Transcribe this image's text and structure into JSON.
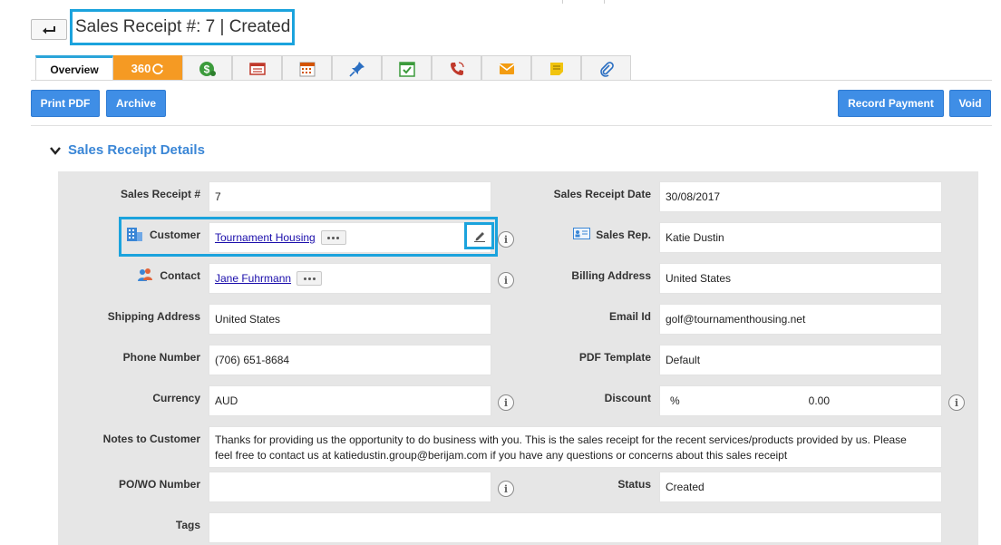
{
  "header": {
    "title": "Sales Receipt #: 7 | Created",
    "back_icon": "back-arrow-icon"
  },
  "tabs": [
    {
      "label": "Overview",
      "icon": "overview"
    },
    {
      "label": "360",
      "icon": "360-refresh-icon"
    },
    {
      "label": "",
      "icon": "payment-dollar-icon"
    },
    {
      "label": "",
      "icon": "invoice-list-icon"
    },
    {
      "label": "",
      "icon": "calendar-icon"
    },
    {
      "label": "",
      "icon": "pin-icon"
    },
    {
      "label": "",
      "icon": "task-check-icon"
    },
    {
      "label": "",
      "icon": "call-phone-icon"
    },
    {
      "label": "",
      "icon": "email-envelope-icon"
    },
    {
      "label": "",
      "icon": "note-icon"
    },
    {
      "label": "",
      "icon": "attachment-paperclip-icon"
    }
  ],
  "toolbar": {
    "print_pdf": "Print PDF",
    "archive": "Archive",
    "record_payment": "Record Payment",
    "void": "Void"
  },
  "section": {
    "title": "Sales Receipt Details"
  },
  "fields": {
    "sales_receipt_no": {
      "label": "Sales Receipt #",
      "value": "7"
    },
    "sales_receipt_date": {
      "label": "Sales Receipt Date",
      "value": "30/08/2017"
    },
    "customer": {
      "label": "Customer",
      "value": "Tournament Housing"
    },
    "sales_rep": {
      "label": "Sales Rep.",
      "value": "Katie Dustin"
    },
    "contact": {
      "label": "Contact",
      "value": "Jane Fuhrmann"
    },
    "billing_address": {
      "label": "Billing Address",
      "value": "United States"
    },
    "shipping_address": {
      "label": "Shipping Address",
      "value": "United States"
    },
    "email_id": {
      "label": "Email Id",
      "value": "golf@tournamenthousing.net"
    },
    "phone_number": {
      "label": "Phone Number",
      "value": "(706) 651-8684"
    },
    "pdf_template": {
      "label": "PDF Template",
      "value": "Default"
    },
    "currency": {
      "label": "Currency",
      "value": "AUD"
    },
    "discount": {
      "label": "Discount",
      "unit": "%",
      "value": "0.00"
    },
    "notes_to_customer": {
      "label": "Notes to Customer",
      "value": "Thanks for providing us the opportunity to do business with you. This is the sales receipt for the recent services/products provided by us. Please feel free to contact us at katiedustin.group@berijam.com if you have any questions or concerns about this sales receipt"
    },
    "po_wo_number": {
      "label": "PO/WO Number",
      "value": ""
    },
    "status": {
      "label": "Status",
      "value": "Created"
    },
    "tags": {
      "label": "Tags",
      "value": ""
    }
  },
  "colors": {
    "primary_button": "#3f8ee6",
    "highlight": "#1ba3dd",
    "tab_360": "#f59a23",
    "section_title": "#3a86d6",
    "panel_bg": "#e6e6e6"
  }
}
